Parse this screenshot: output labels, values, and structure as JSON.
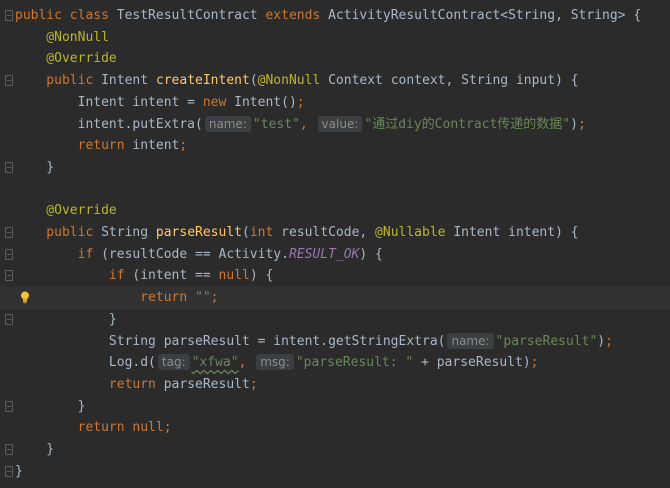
{
  "lines": [
    {
      "segs": [
        [
          "kw",
          "public class "
        ],
        [
          "plain",
          "TestResultContract "
        ],
        [
          "kw",
          "extends "
        ],
        [
          "plain",
          "ActivityResultContract<String, String> {"
        ]
      ]
    },
    {
      "segs": [
        [
          "ann",
          "    @NonNull"
        ]
      ]
    },
    {
      "segs": [
        [
          "ann",
          "    @Override"
        ]
      ]
    },
    {
      "segs": [
        [
          "kw",
          "    public "
        ],
        [
          "plain",
          "Intent "
        ],
        [
          "fn",
          "createIntent"
        ],
        [
          "plain",
          "("
        ],
        [
          "ann",
          "@NonNull "
        ],
        [
          "plain",
          "Context context, "
        ],
        [
          "kw",
          ""
        ],
        [
          "plain",
          "String input) {"
        ]
      ]
    },
    {
      "segs": [
        [
          "plain",
          "        Intent intent = "
        ],
        [
          "kw",
          "new "
        ],
        [
          "plain",
          "Intent()"
        ],
        [
          "kw",
          ";"
        ]
      ]
    },
    {
      "segs": [
        [
          "plain",
          "        intent.putExtra("
        ],
        [
          "hint",
          "name:"
        ],
        [
          "str",
          "\"test\""
        ],
        [
          "kw",
          ", "
        ],
        [
          "hint",
          "value:"
        ],
        [
          "str",
          "\"通过diy的Contract传递的数据\""
        ],
        [
          "plain",
          ")"
        ],
        [
          "kw",
          ";"
        ]
      ]
    },
    {
      "segs": [
        [
          "kw",
          "        return "
        ],
        [
          "plain",
          "intent"
        ],
        [
          "kw",
          ";"
        ]
      ]
    },
    {
      "segs": [
        [
          "plain",
          "    }"
        ]
      ]
    },
    {
      "segs": [
        [
          "plain",
          ""
        ]
      ]
    },
    {
      "segs": [
        [
          "ann",
          "    @Override"
        ]
      ]
    },
    {
      "segs": [
        [
          "kw",
          "    public "
        ],
        [
          "plain",
          "String "
        ],
        [
          "fn",
          "parseResult"
        ],
        [
          "plain",
          "("
        ],
        [
          "kw",
          "int "
        ],
        [
          "plain",
          "resultCode, "
        ],
        [
          "ann",
          "@Nullable "
        ],
        [
          "plain",
          "Intent intent) {"
        ]
      ]
    },
    {
      "segs": [
        [
          "kw",
          "        if "
        ],
        [
          "plain",
          "(resultCode == Activity."
        ],
        [
          "const",
          "RESULT_OK"
        ],
        [
          "plain",
          ") {"
        ]
      ]
    },
    {
      "segs": [
        [
          "kw",
          "            if "
        ],
        [
          "plain",
          "(intent == "
        ],
        [
          "kw",
          "null"
        ],
        [
          "plain",
          ") {"
        ]
      ]
    },
    {
      "segs": [
        [
          "kw",
          "                return "
        ],
        [
          "str",
          "\"\""
        ],
        [
          "kw",
          ";"
        ]
      ]
    },
    {
      "segs": [
        [
          "plain",
          "            }"
        ]
      ]
    },
    {
      "segs": [
        [
          "plain",
          "            String parseResult = intent.getStringExtra("
        ],
        [
          "hint",
          "name:"
        ],
        [
          "str",
          "\"parseResult\""
        ],
        [
          "plain",
          ")"
        ],
        [
          "kw",
          ";"
        ]
      ]
    },
    {
      "segs": [
        [
          "plain",
          "            Log."
        ],
        [
          "plain",
          "d("
        ],
        [
          "hint",
          "tag:"
        ],
        [
          "squig",
          "\"xfwa\""
        ],
        [
          "kw",
          ", "
        ],
        [
          "hint",
          "msg:"
        ],
        [
          "str",
          "\"parseResult: \" "
        ],
        [
          "plain",
          "+ parseResult)"
        ],
        [
          "kw",
          ";"
        ]
      ]
    },
    {
      "segs": [
        [
          "kw",
          "            return "
        ],
        [
          "plain",
          "parseResult"
        ],
        [
          "kw",
          ";"
        ]
      ]
    },
    {
      "segs": [
        [
          "plain",
          "        }"
        ]
      ]
    },
    {
      "segs": [
        [
          "kw",
          "        return null"
        ],
        [
          "kw",
          ";"
        ]
      ]
    },
    {
      "segs": [
        [
          "plain",
          "    }"
        ]
      ]
    },
    {
      "segs": [
        [
          "plain",
          "}"
        ]
      ]
    }
  ],
  "colors": {
    "background": "#2b2b2b",
    "keyword": "#cc7832",
    "annotation": "#bbb529",
    "function": "#ffc66d",
    "string": "#6a8759",
    "constant": "#9876aa",
    "text": "#a9b7c6"
  },
  "icons": {
    "bulb": "intention-bulb-icon",
    "fold": "fold-marker-icon"
  }
}
